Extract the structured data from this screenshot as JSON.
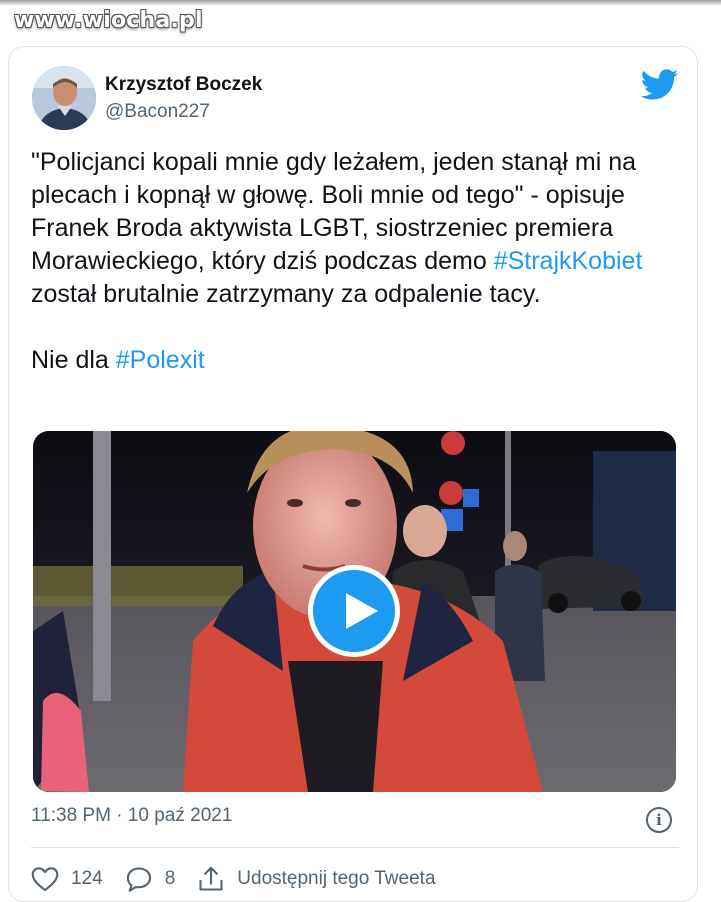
{
  "watermark": "www.wiocha.pl",
  "tweet": {
    "author_name": "Krzysztof Boczek",
    "author_handle": "@Bacon227",
    "text_part1": "\"Policjanci kopali mnie gdy leżałem, jeden stanął mi na plecach i kopnął w głowę. Boli mnie od tego\" - opisuje Franek Broda aktywista LGBT, siostrzeniec premiera Morawieckiego, który dziś podczas demo ",
    "hashtag1": "#StrajkKobiet",
    "text_part2": " został brutalnie zatrzymany za odpalenie tacy.\n\nNie dla ",
    "hashtag2": "#Polexit",
    "timestamp": "11:38 PM · 10 paź 2021",
    "likes": "124",
    "replies": "8",
    "share_label": "Udostępnij tego Tweeta"
  },
  "icons": {
    "brand": "twitter-bird-icon",
    "play": "play-icon",
    "info": "info-icon",
    "like": "heart-icon",
    "reply": "reply-icon",
    "share": "share-icon"
  },
  "colors": {
    "accent": "#1d9bf0",
    "text": "#0f1419",
    "muted": "#536471",
    "border": "#dfe3e7"
  }
}
